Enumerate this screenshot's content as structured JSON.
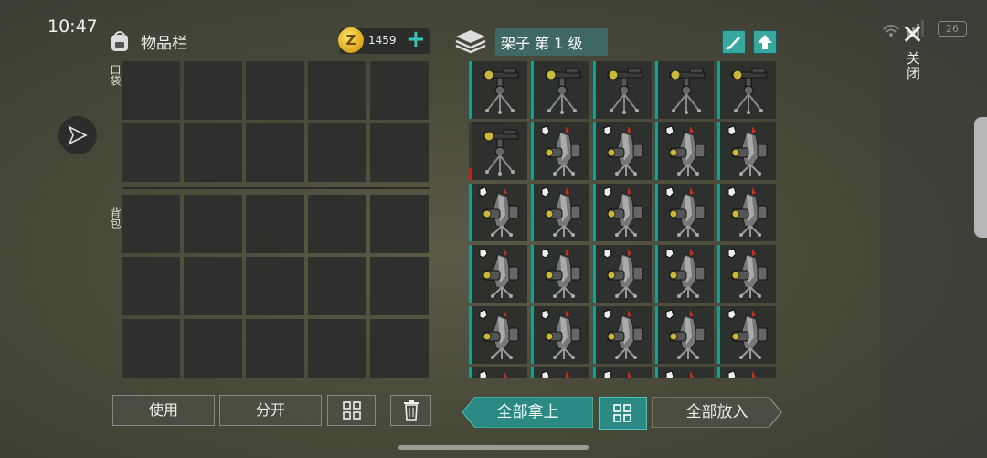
{
  "status": {
    "time": "10:47",
    "battery": "26"
  },
  "sidebar": {
    "close_label": "关闭",
    "close_icon": "close-icon"
  },
  "inventory": {
    "title": "物品栏",
    "coins": "1459",
    "coin_symbol": "Z",
    "pocket_label": "口袋",
    "backpack_label": "背包",
    "pocket_cells": 10,
    "backpack_cells": 15
  },
  "shelf": {
    "title": "架子 第 1 级",
    "items": [
      "tripod",
      "tripod",
      "tripod",
      "tripod",
      "tripod",
      "tripod",
      "turret",
      "turret",
      "turret",
      "turret",
      "turret",
      "turret",
      "turret",
      "turret",
      "turret",
      "turret",
      "turret",
      "turret",
      "turret",
      "turret",
      "turret",
      "turret",
      "turret",
      "turret",
      "turret",
      "turret",
      "turret",
      "turret",
      "turret",
      "turret"
    ]
  },
  "actions": {
    "use": "使用",
    "split": "分开",
    "take_all": "全部拿上",
    "put_all": "全部放入"
  },
  "colors": {
    "accent": "#37a89f",
    "slot": "#2e302d",
    "bar_low": "#c02020"
  }
}
